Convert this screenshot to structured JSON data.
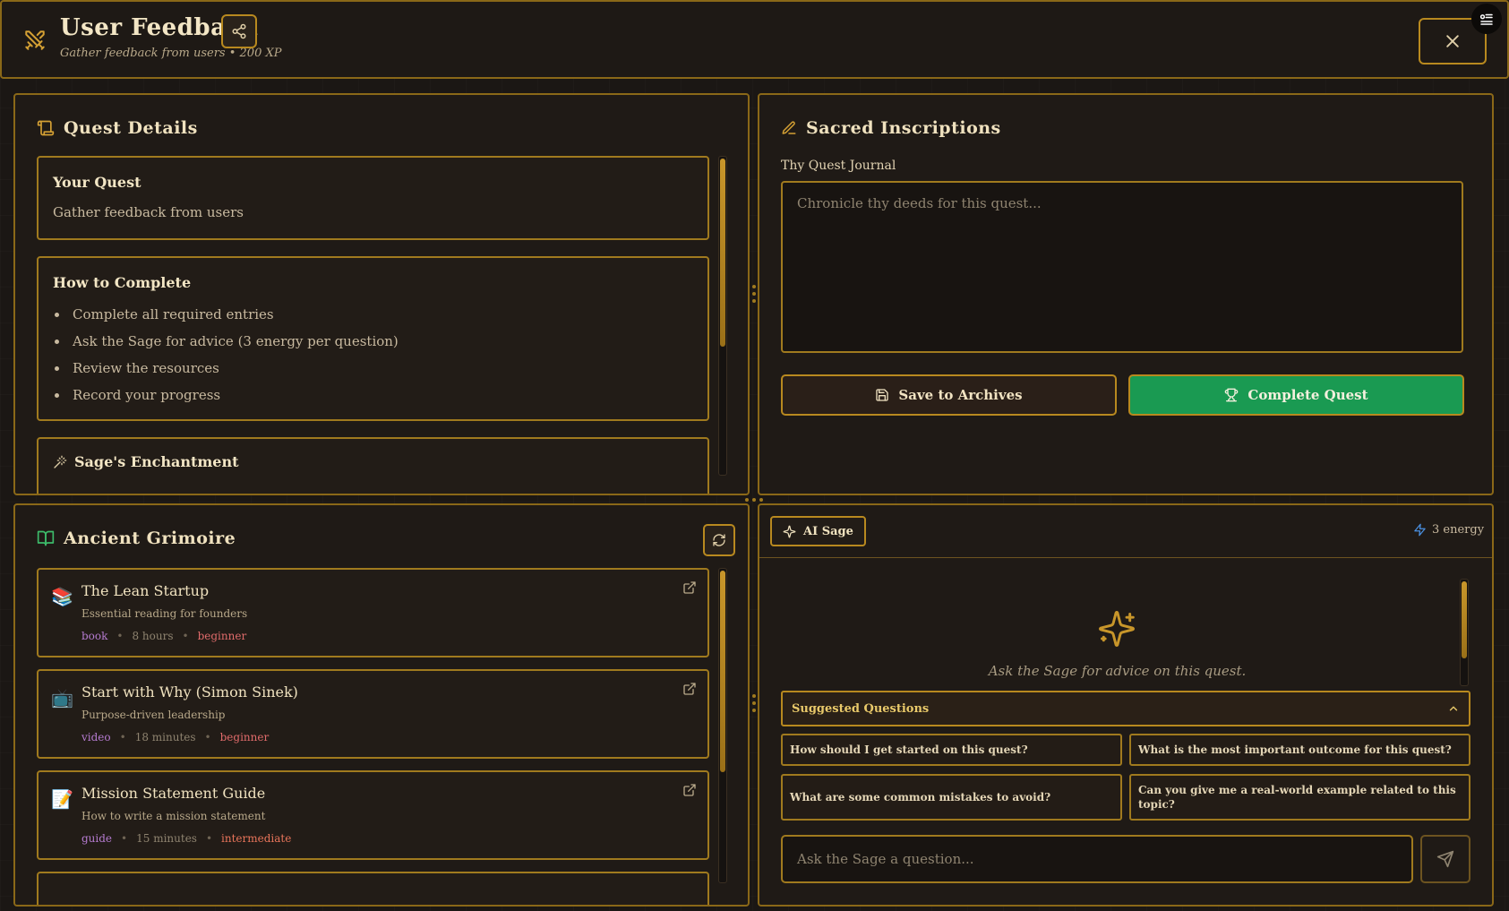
{
  "header": {
    "title": "User Feedback",
    "subtitle": "Gather feedback from users • 200 XP"
  },
  "quest_details": {
    "title": "Quest Details",
    "your_quest": {
      "heading": "Your Quest",
      "text": "Gather feedback from users"
    },
    "how_to": {
      "heading": "How to Complete",
      "items": [
        "Complete all required entries",
        "Ask the Sage for advice (3 energy per question)",
        "Review the resources",
        "Record your progress"
      ]
    },
    "enchantment": {
      "heading": "Sage's Enchantment"
    }
  },
  "inscriptions": {
    "title": "Sacred Inscriptions",
    "journal_label": "Thy Quest Journal",
    "journal_placeholder": "Chronicle thy deeds for this quest...",
    "save_label": "Save to Archives",
    "complete_label": "Complete Quest"
  },
  "grimoire": {
    "title": "Ancient Grimoire",
    "resources": [
      {
        "icon": "books-emoji",
        "emoji": "📚",
        "title": "The Lean Startup",
        "desc": "Essential reading for founders",
        "type": "book",
        "duration": "8 hours",
        "level": "beginner"
      },
      {
        "icon": "tv-emoji",
        "emoji": "📺",
        "title": "Start with Why (Simon Sinek)",
        "desc": "Purpose-driven leadership",
        "type": "video",
        "duration": "18 minutes",
        "level": "beginner"
      },
      {
        "icon": "memo-emoji",
        "emoji": "📝",
        "title": "Mission Statement Guide",
        "desc": "How to write a mission statement",
        "type": "guide",
        "duration": "15 minutes",
        "level": "intermediate"
      }
    ]
  },
  "sage": {
    "tag_label": "AI Sage",
    "energy": "3 energy",
    "empty_text": "Ask the Sage for advice on this quest.",
    "suggested_header": "Suggested Questions",
    "questions": [
      "How should I get started on this quest?",
      "What is the most important outcome for this quest?",
      "What are some common mistakes to avoid?",
      "Can you give me a real-world example related to this topic?"
    ],
    "input_placeholder": "Ask the Sage a question..."
  },
  "colors": {
    "gold": "#b8891f",
    "complete_green": "#1a9a52",
    "background": "#1b1714"
  }
}
